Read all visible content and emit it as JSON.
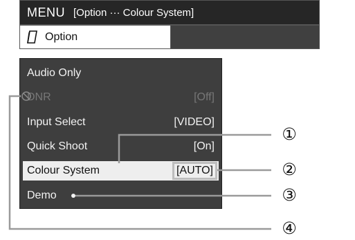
{
  "menu": {
    "title": "MENU",
    "path": "[Option ··· Colour System]"
  },
  "option": {
    "label": "Option",
    "icon": "option-icon"
  },
  "items": [
    {
      "label": "Audio Only",
      "value": ""
    },
    {
      "label": "DNR",
      "value": "[Off]",
      "disabled": true,
      "icon": "prohibited-icon"
    },
    {
      "label": "Input Select",
      "value": "[VIDEO]"
    },
    {
      "label": "Quick Shoot",
      "value": "[On]"
    },
    {
      "label": "Colour System",
      "value": "[AUTO]",
      "selected": true
    },
    {
      "label": "Demo",
      "value": ""
    }
  ],
  "callouts": [
    "①",
    "②",
    "③",
    "④"
  ],
  "colors": {
    "menu_bar_bg": "#262626",
    "panel_bg": "#3e3e3e",
    "highlight_bg": "#eeeeee",
    "leader_line": "#9a9a9a"
  }
}
